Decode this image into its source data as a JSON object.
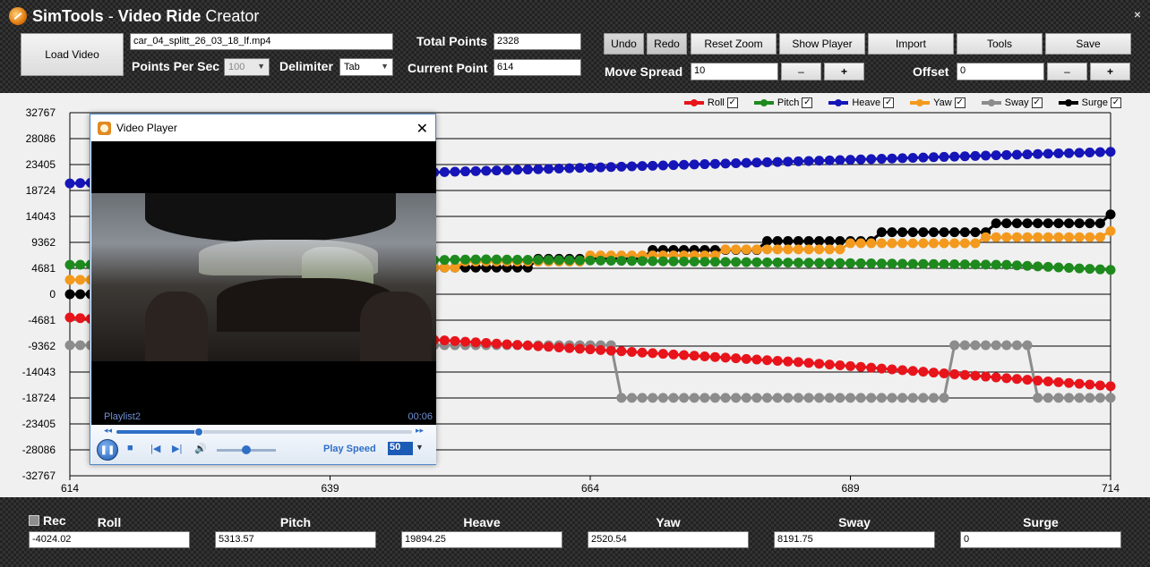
{
  "app": {
    "title_bold": "SimTools",
    "title_sep": " - ",
    "title_bold2": "Video Ride",
    "title_rest": " Creator",
    "close": "×"
  },
  "toolbar": {
    "load_video": "Load Video",
    "video_file": "car_04_splitt_26_03_18_lf.mp4",
    "points_per_sec_label": "Points Per Sec",
    "points_per_sec_value": "100",
    "delimiter_label": "Delimiter",
    "delimiter_value": "Tab",
    "total_points_label": "Total Points",
    "total_points_value": "2328",
    "current_point_label": "Current Point",
    "current_point_value": "614",
    "undo": "Undo",
    "redo": "Redo",
    "reset_zoom": "Reset Zoom",
    "show_player": "Show Player",
    "import": "Import",
    "tools": "Tools",
    "save": "Save",
    "move_spread_label": "Move Spread",
    "move_spread_value": "10",
    "offset_label": "Offset",
    "offset_value": "0",
    "minus": "–",
    "plus": "+"
  },
  "legend": [
    {
      "name": "Roll",
      "color": "#e8141b",
      "checked": "✓"
    },
    {
      "name": "Pitch",
      "color": "#1e8a1e",
      "checked": "✓"
    },
    {
      "name": "Heave",
      "color": "#1515b8",
      "checked": "✓"
    },
    {
      "name": "Yaw",
      "color": "#f39a1e",
      "checked": "✓"
    },
    {
      "name": "Sway",
      "color": "#8c8c8c",
      "checked": "✓"
    },
    {
      "name": "Surge",
      "color": "#000000",
      "checked": "✓"
    }
  ],
  "chart_data": {
    "type": "line",
    "x_ticks": [
      "614",
      "639",
      "664",
      "689",
      "714"
    ],
    "y_ticks": [
      "32767",
      "28086",
      "23405",
      "18724",
      "14043",
      "9362",
      "4681",
      "0",
      "-4681",
      "-9362",
      "-14043",
      "-18724",
      "-23405",
      "-28086",
      "-32767"
    ],
    "xlim": [
      614,
      714
    ],
    "ylim": [
      -32767,
      32767
    ],
    "grid": true,
    "legend_position": "top-right"
  },
  "player": {
    "title": "Video Player",
    "close": "✕",
    "playlist": "Playlist2",
    "time": "00:06",
    "play_speed_label": "Play Speed",
    "play_speed_value": "50",
    "seek_fraction": 0.28
  },
  "bottom": {
    "rec_label": "Rec",
    "fields": [
      {
        "label": "Roll",
        "value": "-4024.02"
      },
      {
        "label": "Pitch",
        "value": "5313.57"
      },
      {
        "label": "Heave",
        "value": "19894.25"
      },
      {
        "label": "Yaw",
        "value": "2520.54"
      },
      {
        "label": "Sway",
        "value": "8191.75"
      },
      {
        "label": "Surge",
        "value": "0"
      }
    ]
  }
}
